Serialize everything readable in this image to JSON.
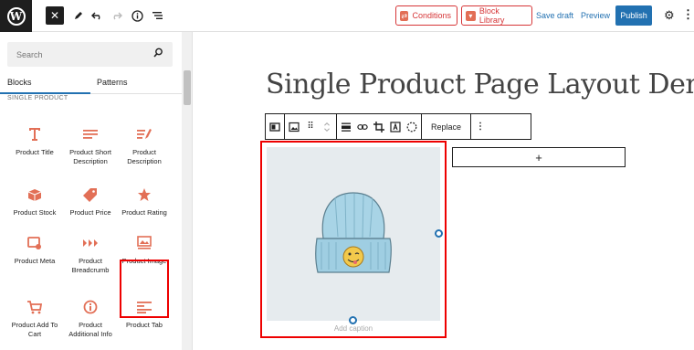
{
  "topbar": {
    "close_label": "✕",
    "conditions_label": "Conditions",
    "block_library_label": "Block Library",
    "save_draft_label": "Save draft",
    "preview_label": "Preview",
    "publish_label": "Publish"
  },
  "sidebar": {
    "search_placeholder": "Search",
    "tabs": [
      {
        "label": "Blocks"
      },
      {
        "label": "Patterns"
      }
    ],
    "category_title": "SINGLE PRODUCT",
    "blocks": [
      {
        "label": "Product Title",
        "icon": "title-icon"
      },
      {
        "label": "Product Short Description",
        "icon": "short-description-icon"
      },
      {
        "label": "Product Description",
        "icon": "description-icon"
      },
      {
        "label": "Product Stock",
        "icon": "stock-box-icon"
      },
      {
        "label": "Product Price",
        "icon": "price-tag-icon"
      },
      {
        "label": "Product Rating",
        "icon": "star-icon"
      },
      {
        "label": "Product Meta",
        "icon": "meta-icon"
      },
      {
        "label": "Product Breadcrumb",
        "icon": "breadcrumb-icon"
      },
      {
        "label": "Product Image",
        "icon": "image-icon"
      },
      {
        "label": "Product Add To Cart",
        "icon": "cart-icon"
      },
      {
        "label": "Product Additional Info",
        "icon": "additional-info-icon"
      },
      {
        "label": "Product Tab",
        "icon": "tab-icon"
      }
    ]
  },
  "canvas": {
    "page_title": "Single Product Page Layout Demo",
    "toolbar": {
      "replace_label": "Replace"
    },
    "caption_placeholder": "Add caption",
    "add_block_label": "+"
  },
  "colors": {
    "accent_blue": "#2271b1",
    "brand_orange": "#e26f56",
    "highlight_red": "#ee0000"
  }
}
